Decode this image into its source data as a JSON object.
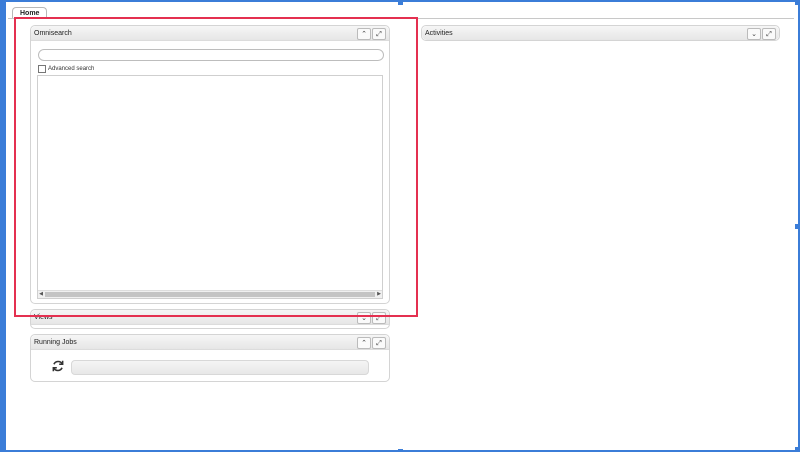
{
  "tabs": [
    {
      "label": "Home"
    }
  ],
  "panels": {
    "omnisearch": {
      "title": "Omnisearch",
      "advanced_search_label": "Advanced search",
      "search_value": ""
    },
    "activities": {
      "title": "Activities"
    },
    "views": {
      "title": "Views"
    },
    "running_jobs": {
      "title": "Running Jobs"
    }
  },
  "icons": {
    "collapse": "chevron-up-icon",
    "expand_down": "chevron-down-icon",
    "maximize": "maximize-icon",
    "refresh": "refresh-icon"
  },
  "colors": {
    "selection_outline": "#e43050",
    "frame": "#3b7dd8"
  }
}
